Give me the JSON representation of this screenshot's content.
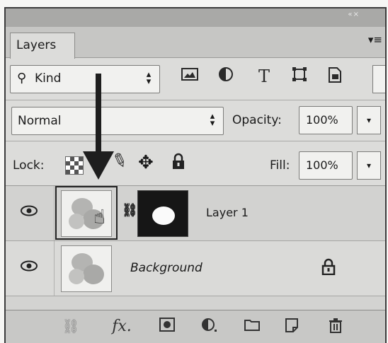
{
  "window": {
    "collapse_glyph": "«  ×"
  },
  "panel": {
    "tab_label": "Layers",
    "menu_icon": "panel-menu-icon"
  },
  "filter": {
    "kind_label": "Kind",
    "icons": [
      "image-filter-icon",
      "adjustment-filter-icon",
      "type-filter-icon",
      "shape-filter-icon",
      "smart-object-filter-icon"
    ]
  },
  "blend": {
    "mode": "Normal",
    "opacity_label": "Opacity:",
    "opacity_value": "100%"
  },
  "lock": {
    "label": "Lock:",
    "fill_label": "Fill:",
    "fill_value": "100%",
    "icons": [
      "lock-transparent-pixels-icon",
      "lock-image-pixels-icon",
      "lock-position-icon",
      "lock-all-icon"
    ]
  },
  "layers": [
    {
      "name": "Layer 1",
      "visible": true,
      "has_mask": true,
      "selected_thumbnail": true
    },
    {
      "name": "Background",
      "visible": true,
      "locked": true
    }
  ],
  "footer": {
    "icons": [
      "link-layers-icon",
      "fx-icon",
      "add-mask-icon",
      "new-adjustment-icon",
      "new-group-icon",
      "new-layer-icon",
      "delete-layer-icon"
    ]
  }
}
